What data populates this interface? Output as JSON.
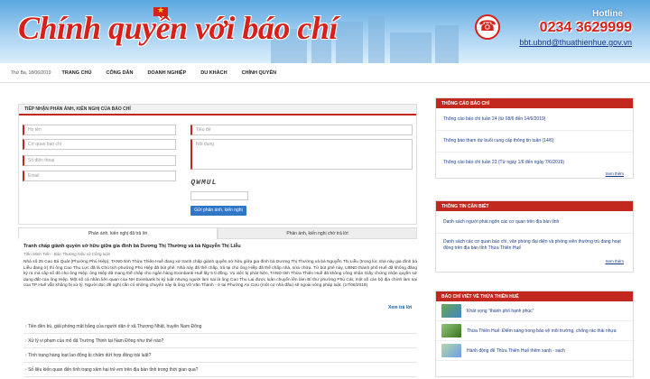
{
  "header": {
    "title": "Chính quyền với báo chí",
    "hotline_label": "Hotline",
    "hotline_number": "0234 3629999",
    "hotline_email": "bbt.ubnd@thuathienhue.gov.vn"
  },
  "nav": {
    "date": "Thứ Ba, 18/06/2019",
    "items": [
      "TRANG CHỦ",
      "CÔNG DÂN",
      "DOANH NGHIỆP",
      "DU KHÁCH",
      "CHÍNH QUYỀN"
    ]
  },
  "form": {
    "heading": "TIẾP NHẬN PHẢN ÁNH, KIẾN NGHỊ CỦA BÁO CHÍ",
    "fullname_placeholder": "Họ tên",
    "agency_placeholder": "Cơ quan báo chí",
    "phone_placeholder": "Số điện thoại",
    "email_placeholder": "Email",
    "subject_placeholder": "Tiêu đề",
    "content_placeholder": "Nội dung",
    "captcha_text": "QWMUL",
    "submit_label": "Gửi phản ánh, kiến nghị"
  },
  "tabs": {
    "answered": "Phản ánh, kiến nghị đã trả lời",
    "pending": "Phản ánh, kiến nghị chờ trả lời"
  },
  "article": {
    "title": "Tranh chấp giành quyền sở hữu giữa gia đình bà Dương Thị Thường và bà Nguyễn Thị Liễu",
    "meta": "Tiền Minh Tiên - Báo Thương hiệu và Công luận",
    "body": "Nhà số 25 Cao Bá Quát (Phường Phú Hiệp), TAND tỉnh Thừa Thiên Huế đang xử tranh chấp giành quyền sở hữu giữa gia đình bà Dương Thị Thường và bà Nguyễn Thị Liễu (trong lúc nhà này gia đình bà Liễu đang ở) thì ông Cao Thu Lực đã là Chủ tịch phường Phú Hiệp đã bút phê. Nhà này đã thế chấp, trả lại cho ông Hiếp đã thế chấp nhà, sửa chữa. Từ bút phê này, UBND thành phố Huế đã không đăng ký ra mà cấp sổ đỏ cho ông Hiệp. ông Hiệp đã mang thế chấp cho ngân hàng Eximbank Huế lấy 5 tỉ đồng. Vụ việc bị phát hiện, TAND tỉnh Thừa Thiên Huế đã không công nhận Giấy chứng nhận quyền sử dụng đất của ông Hiệp. Một số cá nhân liên quan của NH Eximbank bị kỷ luật nhưng người làm sai là ông Cao Thu Lai được luân chuyển lên làm Bí thư phường Phú Cát, một số cán bộ địa chính làm sai của TP Huế vẫn không bị xử lý. Người đọc đề nghị cần có những chuyển này là ông Võ Văn Thành - ở tại Phường An Cựu (một cơ nhà đầu) sẽ ngoài vòng pháp luật. (17/06/2019)",
    "see_reply": "Xem trả lời"
  },
  "questions": [
    "Tiền đền bù, giải phóng mặt bằng của người dân ở xã Thượng Nhật, huyện Nam Đông",
    "Xử lý vi phạm của mỏ đá Trường Thịnh tại Nam Đông như thế nào?",
    "Tình trạng hàng loạt lao động bị chấm dứt hợp đồng trái luật?",
    "Số liệu kiến quan đến tình trạng xâm hại trẻ em trên địa bàn tỉnh trong thời gian qua?"
  ],
  "sidebar": {
    "press_releases": {
      "heading": "THÔNG CÁO BÁO CHÍ",
      "items": [
        "Thông cáo báo chí tuần 24 (từ 08/6 đến 14/6/2019)",
        "Thông báo tham dự buổi cung cấp thông tin tuần (14/6)",
        "Thông cáo báo chí tuần 23 (Từ ngày 1/6 đến ngày 7/6/2019)"
      ],
      "more": "Xem thêm"
    },
    "news_to_know": {
      "heading": "THÔNG TIN CẦN BIẾT",
      "items": [
        "Danh sách người phát ngôn các cơ quan trên địa bàn tỉnh",
        "Danh sách các cơ quan báo chí, văn phòng đại diện và phóng viên thường trú đang hoạt động trên địa bàn tỉnh Thừa Thiên Huế"
      ],
      "more": "Xem thêm"
    },
    "press_about": {
      "heading": "BÁO CHÍ VIẾT VỀ THỪA THIÊN HUẾ",
      "items": [
        "Khát vọng \"thành phố hạnh phúc\"",
        "Thừa Thiên Huế: Điểm sáng trong bảo vệ môi trường, chống rác thải nhựa",
        "Hành động để Thừa Thiên Huế thêm xanh - sạch"
      ]
    }
  },
  "colors": {
    "accent_red": "#c2281e",
    "link_blue": "#1b3a8a",
    "button_blue": "#2f76c7"
  }
}
